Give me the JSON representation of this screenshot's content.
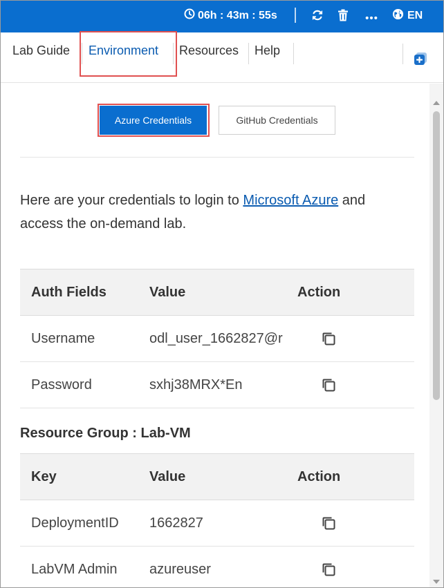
{
  "topbar": {
    "timer": "06h : 43m : 55s",
    "language": "EN",
    "icons": [
      "clock-icon",
      "refresh-icon",
      "trash-icon",
      "more-icon",
      "globe-icon"
    ],
    "bg_color": "#0a6ecf"
  },
  "tabs": [
    {
      "label": "Lab Guide",
      "active": false
    },
    {
      "label": "Environment",
      "active": true
    },
    {
      "label": "Resources",
      "active": false
    },
    {
      "label": "Help",
      "active": false
    }
  ],
  "credential_buttons": {
    "azure": "Azure Credentials",
    "github": "GitHub Credentials"
  },
  "intro": {
    "before": "Here are your credentials to login to ",
    "link": "Microsoft Azure",
    "after": " and access the on-demand lab."
  },
  "auth_table": {
    "headers": [
      "Auth Fields",
      "Value",
      "Action"
    ],
    "rows": [
      {
        "field": "Username",
        "value": "odl_user_1662827@r"
      },
      {
        "field": "Password",
        "value": "sxhj38MRX*En"
      }
    ]
  },
  "resource_group": {
    "title": "Resource Group : Lab-VM",
    "headers": [
      "Key",
      "Value",
      "Action"
    ],
    "rows": [
      {
        "key": "DeploymentID",
        "value": "1662827"
      },
      {
        "key": "LabVM Admin",
        "value": "azureuser"
      }
    ]
  },
  "colors": {
    "accent": "#0a6ecf",
    "highlight": "#e05050",
    "link": "#0a5bb0"
  }
}
